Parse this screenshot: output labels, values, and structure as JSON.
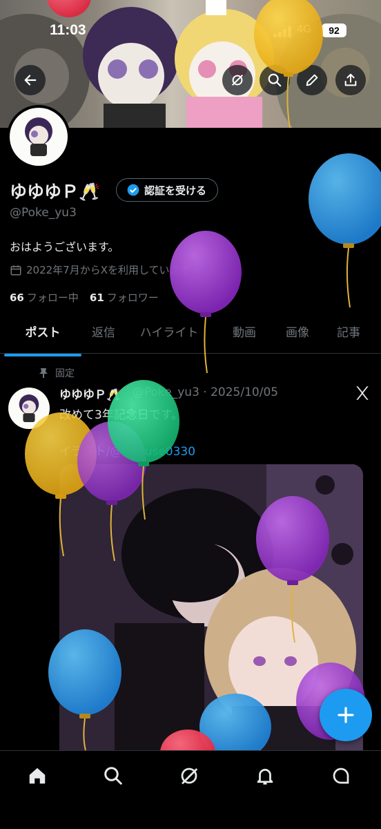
{
  "status_bar": {
    "time": "11:03",
    "network": "4G",
    "battery": "92"
  },
  "profile": {
    "name": "ゆゆゆＰ🥂",
    "verify_button": "認証を受ける",
    "handle": "@Poke_yu3",
    "bio": "おはようございます。",
    "joined": "2022年7月からXを利用しています",
    "following_count": "66",
    "following_label": "フォロー中",
    "followers_count": "61",
    "followers_label": "フォロワー"
  },
  "tabs": [
    "ポスト",
    "返信",
    "ハイライト",
    "動画",
    "画像",
    "記事"
  ],
  "post": {
    "pinned_label": "固定",
    "author_name": "ゆゆゆＰ🥂",
    "author_meta": "@Poke_yu3 · 2025/10/05",
    "text": "改めて3年記念日です。",
    "link_text": "イラスト/@fumuse0330"
  },
  "icons": {
    "back": "back-arrow-icon",
    "retweet": "retweet-icon",
    "search": "search-icon",
    "edit": "edit-icon",
    "share": "share-icon",
    "verified": "verified-badge-icon",
    "calendar": "calendar-icon",
    "pin": "pin-icon",
    "grok": "grok-icon",
    "compose": "compose-plus-icon",
    "home": "home-icon",
    "explore": "explore-search-icon",
    "grok_nav": "grok-nav-icon",
    "notifications": "bell-icon",
    "messages": "messages-icon"
  },
  "colors": {
    "accent": "#1d9bf0",
    "text": "#e7e9ea",
    "muted": "#71767b",
    "border": "#2f3336",
    "background": "#000000"
  }
}
